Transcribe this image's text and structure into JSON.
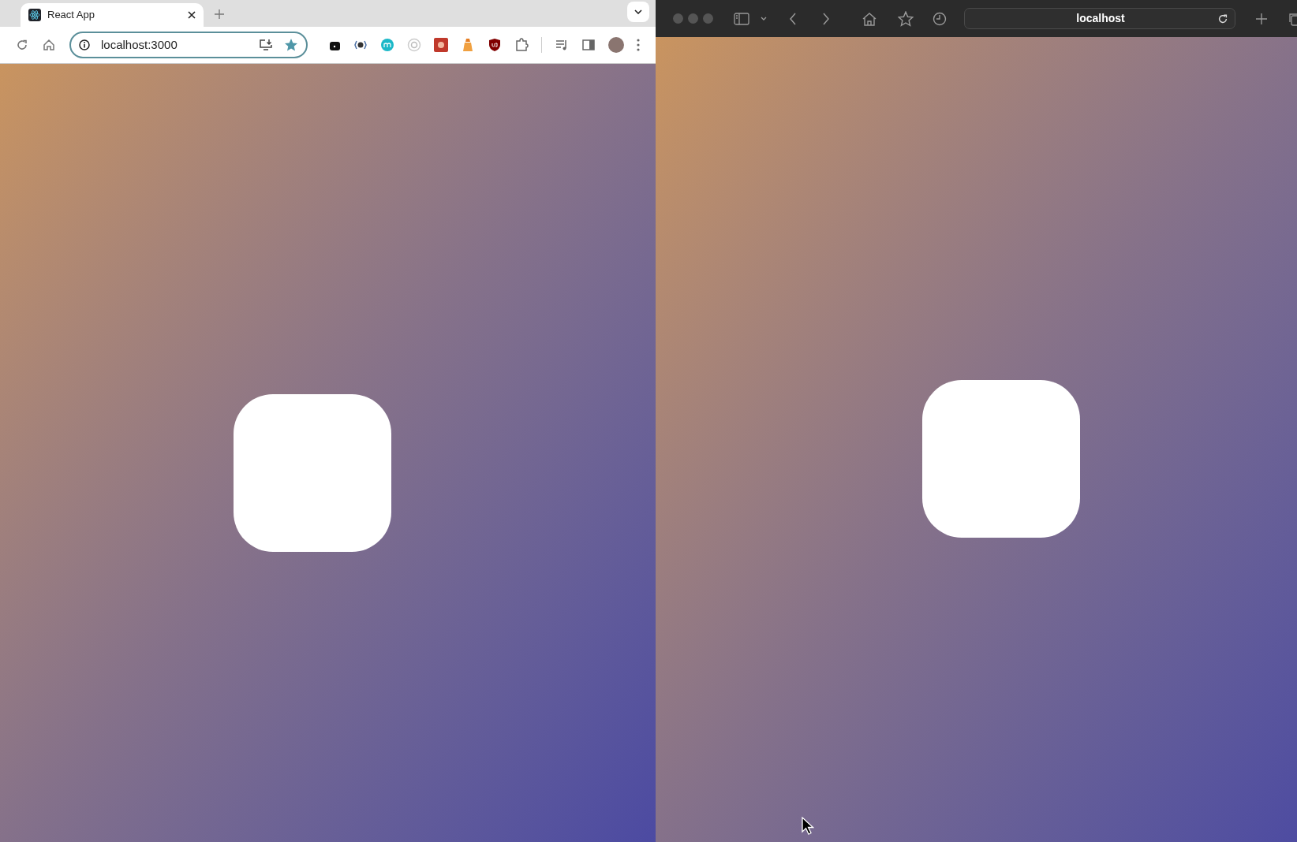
{
  "chrome_window": {
    "tab": {
      "title": "React App"
    },
    "address_bar": {
      "url": "localhost:3000"
    }
  },
  "safari_window": {
    "address_bar": {
      "url": "localhost"
    }
  }
}
